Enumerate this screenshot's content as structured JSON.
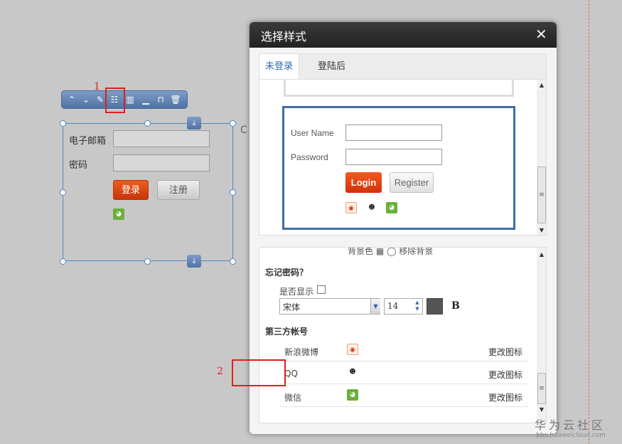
{
  "toolbar": {
    "marker_number": "1",
    "buttons": [
      "chevron-up",
      "chevron-down",
      "edit",
      "style-list",
      "columns",
      "align-bottom",
      "unlock",
      "trash"
    ]
  },
  "widget": {
    "email_label": "电子邮箱",
    "password_label": "密码",
    "login_label": "登录",
    "register_label": "注册",
    "bg_fragment": "C"
  },
  "dialog": {
    "title": "选择样式",
    "close_glyph": "✕",
    "tabs": [
      {
        "label": "未登录",
        "active": true
      },
      {
        "label": "登陆后",
        "active": false
      }
    ],
    "preview": {
      "username_label": "User Name",
      "password_label": "Password",
      "login_label": "Login",
      "register_label": "Register",
      "icons": [
        "weibo-icon",
        "qq-icon",
        "wechat-icon"
      ]
    },
    "settings": {
      "bg_row": "背景色 ▦ ◯ 移除背景",
      "forgot_title": "忘记密码？",
      "show_label": "是否显示",
      "show_checked": false,
      "font_value": "宋体",
      "size_value": "14",
      "font_color": "#555555",
      "bold_label": "B",
      "third_party_title": "第三方帐号",
      "accounts": [
        {
          "name": "新浪微博",
          "icon": "weibo-icon",
          "action": "更改图标"
        },
        {
          "name": "QQ",
          "icon": "qq-icon",
          "action": "更改图标"
        },
        {
          "name": "微信",
          "icon": "wechat-icon",
          "action": "更改图标"
        }
      ],
      "marker_number": "2"
    }
  },
  "watermark": {
    "main": "华为云社区",
    "sub": "bbs.huaweicloud.com"
  }
}
